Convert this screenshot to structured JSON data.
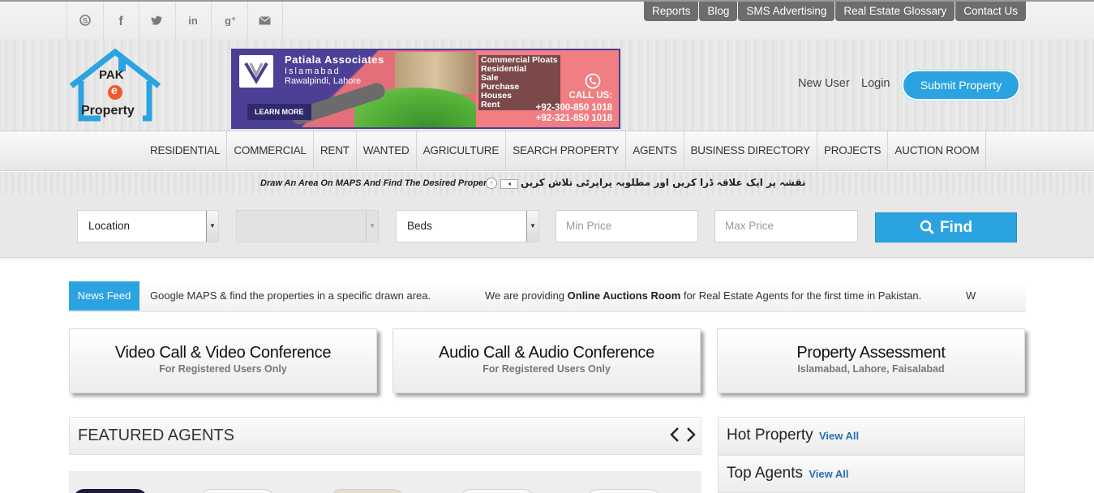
{
  "topbar": {
    "social_icons": [
      "skype-icon",
      "facebook-icon",
      "twitter-icon",
      "linkedin-icon",
      "google-plus-icon",
      "email-icon"
    ],
    "links": [
      "Reports",
      "Blog",
      "SMS Advertising",
      "Real Estate Glossary",
      "Contact Us"
    ]
  },
  "header": {
    "logo": {
      "line1": "PAK",
      "line2": "e",
      "line3": "Property"
    },
    "banner": {
      "title": "Patiala Associates",
      "subtitle1": "Islamabad",
      "subtitle2": "Rawalpindi, Lahore",
      "learn_more": "LEARN MORE",
      "services": [
        "Commercial Ploats",
        "Residential",
        "Sale",
        "Purchase",
        "Houses",
        "Rent"
      ],
      "call_us": "CALL US:",
      "phone1": "+92-300-850 1018",
      "phone2": "+92-321-850 1018"
    },
    "new_user": "New User",
    "login": "Login",
    "submit_property": "Submit Property"
  },
  "nav": {
    "items": [
      "RESIDENTIAL",
      "COMMERCIAL",
      "RENT",
      "WANTED",
      "AGRICULTURE",
      "SEARCH PROPERTY",
      "AGENTS",
      "BUSINESS DIRECTORY",
      "PROJECTS",
      "AUCTION ROOM"
    ]
  },
  "draw_strip": {
    "english": "Draw An Area On MAPS And Find The Desired Property",
    "urdu": "نقشہ پر ایک علاقہ ڈرا کریں اور مطلوبہ پراپرٹی تلاش کریں"
  },
  "search": {
    "location": "Location",
    "second_select": "",
    "beds": "Beds",
    "min_price_placeholder": "Min Price",
    "max_price_placeholder": "Max Price",
    "find": "Find"
  },
  "newsfeed": {
    "label": "News Feed",
    "item1": "Google MAPS & find the properties in a specific drawn area.",
    "item2_pre": "We are providing ",
    "item2_bold": "Online Auctions Room",
    "item2_post": " for Real Estate Agents for the first time in Pakistan.",
    "item3": "W"
  },
  "cards": [
    {
      "title": "Video Call & Video Conference",
      "subtitle": "For Registered Users Only"
    },
    {
      "title": "Audio Call & Audio Conference",
      "subtitle": "For Registered Users Only"
    },
    {
      "title": "Property Assessment",
      "subtitle": "Islamabad, Lahore, Faisalabad"
    }
  ],
  "featured_agents": {
    "title": "FEATURED AGENTS",
    "prev": "‹",
    "next": "›"
  },
  "side": {
    "hot_property": "Hot Property",
    "top_agents": "Top Agents",
    "view_all": "View All"
  },
  "colors": {
    "accent": "#2ba3e0",
    "toplink_bg": "#6d6d6d",
    "banner_pink": "#f07e82",
    "banner_purple": "#4b3d8f"
  }
}
